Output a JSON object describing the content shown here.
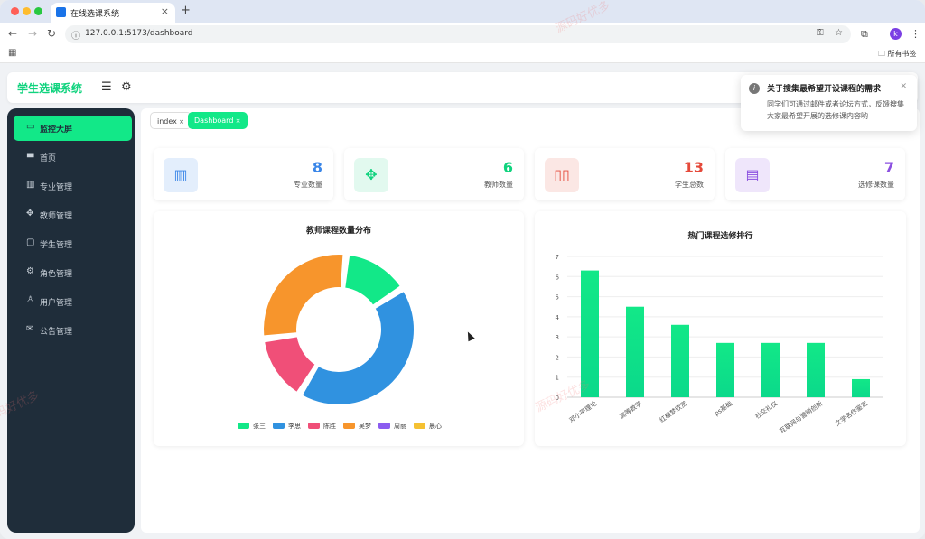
{
  "browser": {
    "tab_title": "在线选课系统",
    "url": "127.0.0.1:5173/dashboard",
    "bookmarks_label": "所有书签",
    "profile_initial": "k"
  },
  "header": {
    "brand": "学生选课系统"
  },
  "sidebar": {
    "items": [
      {
        "label": "监控大屏",
        "icon": "monitor-icon",
        "active": true
      },
      {
        "label": "首页",
        "icon": "desktop-icon",
        "active": false
      },
      {
        "label": "专业管理",
        "icon": "building-icon",
        "active": false
      },
      {
        "label": "教师管理",
        "icon": "move-icon",
        "active": false
      },
      {
        "label": "学生管理",
        "icon": "briefcase-icon",
        "active": false
      },
      {
        "label": "角色管理",
        "icon": "gear-icon",
        "active": false
      },
      {
        "label": "用户管理",
        "icon": "user-icon",
        "active": false
      },
      {
        "label": "公告管理",
        "icon": "mail-icon",
        "active": false
      }
    ]
  },
  "tags": [
    {
      "label": "index",
      "active": false
    },
    {
      "label": "Dashboard",
      "active": true
    }
  ],
  "stats": [
    {
      "value": "8",
      "label": "专业数量",
      "color": "#3a86e8",
      "bg": "#e3eefc",
      "icon": "building-icon"
    },
    {
      "value": "6",
      "label": "教师数量",
      "color": "#10d37e",
      "bg": "#e2f9ef",
      "icon": "move-icon"
    },
    {
      "value": "13",
      "label": "学生总数",
      "color": "#e5493a",
      "bg": "#fbe7e4",
      "icon": "book-icon"
    },
    {
      "value": "7",
      "label": "选修课数量",
      "color": "#8b4fe0",
      "bg": "#efe6fb",
      "icon": "notebook-icon"
    }
  ],
  "notification": {
    "title": "关于搜集最希望开设课程的需求",
    "body": "同学们可通过邮件或者论坛方式，反馈搜集大家最希望开展的选修课内容哟"
  },
  "watermark": "源码好优多",
  "chart_data": [
    {
      "type": "pie",
      "title": "教师课程数量分布",
      "labels": [
        "张三",
        "李思",
        "陈胜",
        "吴梦",
        "周丽",
        "晨心"
      ],
      "values": [
        1,
        3,
        1,
        2,
        0,
        0
      ],
      "colors": [
        "#12e888",
        "#3092e0",
        "#f04f78",
        "#f7952c",
        "#8b5cf0",
        "#f5c132"
      ],
      "legend": "bottom"
    },
    {
      "type": "bar",
      "title": "热门课程选修排行",
      "categories": [
        "邓小平理论",
        "高等数学",
        "红楼梦欣赏",
        "ps基础",
        "社交礼仪",
        "互联网与营销创新",
        "文学名作鉴赏"
      ],
      "values": [
        6.3,
        4.5,
        3.6,
        2.7,
        2.7,
        2.7,
        0.9
      ],
      "ylim": [
        0,
        7
      ],
      "yticks": [
        "0",
        "1",
        "2",
        "3",
        "4",
        "5",
        "6",
        "7"
      ],
      "grid": true,
      "color": "#12e888"
    }
  ]
}
